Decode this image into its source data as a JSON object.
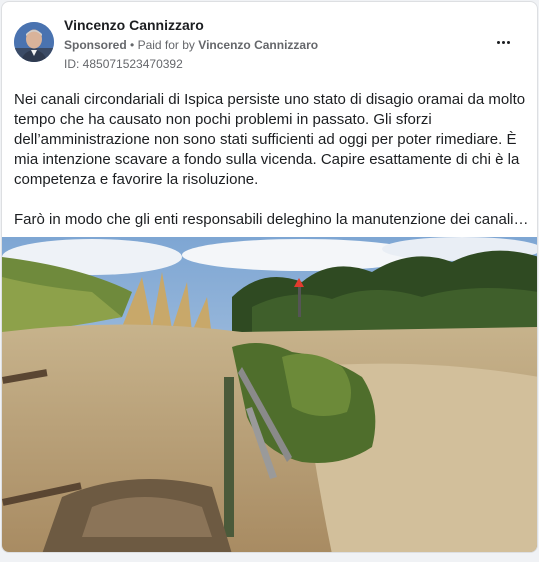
{
  "post": {
    "author": "Vincenzo Cannizzaro",
    "sponsored_label": "Sponsored",
    "separator": "•",
    "paid_for_prefix": "Paid for by",
    "paid_for_name": "Vincenzo Cannizzaro",
    "ad_id": "ID: 485071523470392",
    "menu_icon": "more-options-icon",
    "text_paragraph_1": "Nei canali circondariali di Ispica persiste uno stato di disagio oramai da molto tempo che ha causato non pochi problemi in passato. Gli sforzi dell’amministrazione non sono stati sufficienti ad oggi per poter rimediare. È mia intenzione scavare a fondo sulla vicenda. Capire esattamente di chi è la competenza e favorire la risoluzione.",
    "text_paragraph_2": "Farò in modo che gli enti responsabili deleghino la manutenzione dei canali…"
  },
  "colors": {
    "text": "#1c1e21",
    "secondary_text": "#65676b",
    "card_border": "#dddfe2",
    "sky": "#8fb4d9",
    "water": "#b9a27c"
  }
}
